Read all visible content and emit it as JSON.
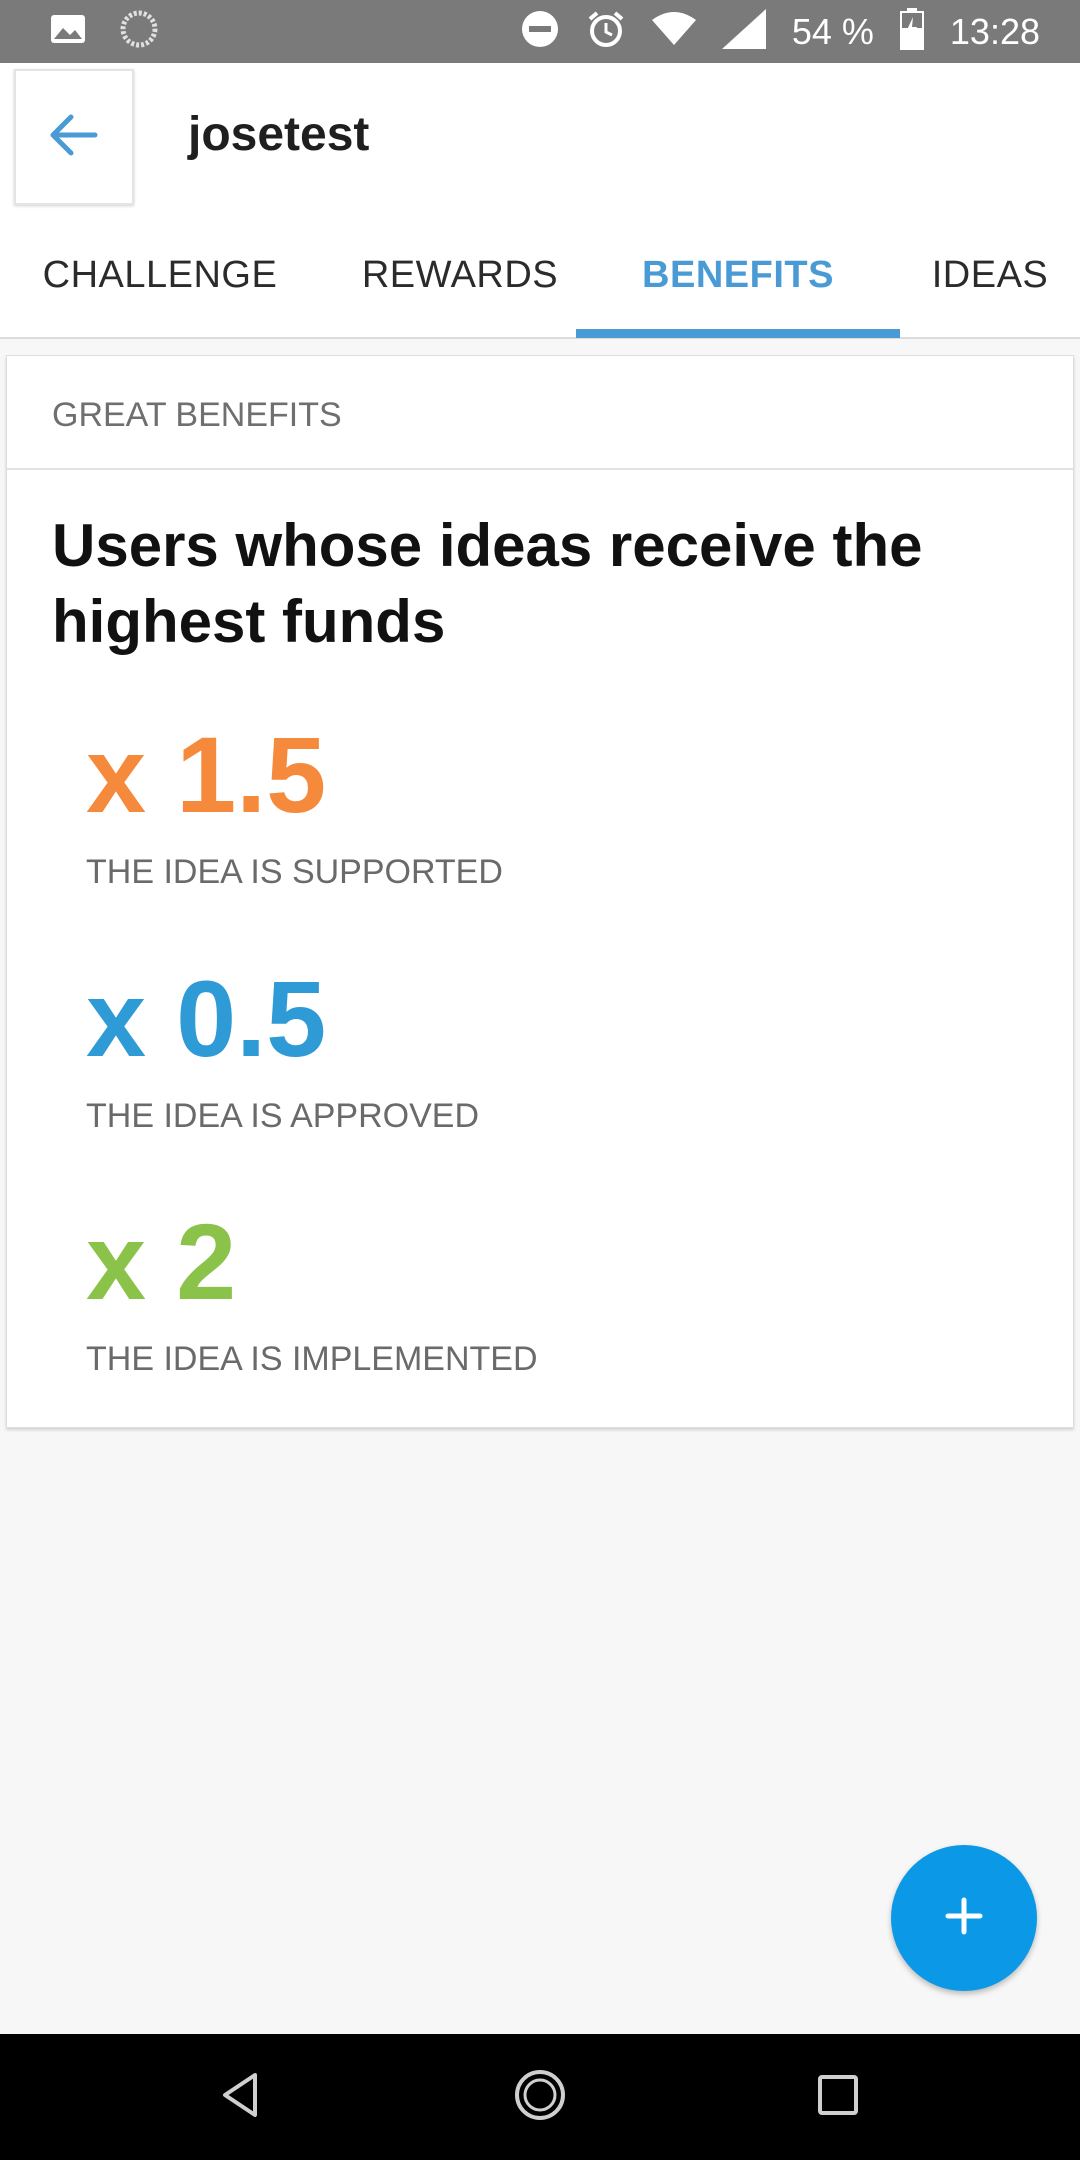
{
  "status_bar": {
    "battery_text": "54 %",
    "time": "13:28",
    "icons": [
      "image-icon",
      "sync-icon",
      "do-not-disturb-icon",
      "alarm-icon",
      "wifi-icon",
      "signal-icon",
      "battery-icon"
    ]
  },
  "app_bar": {
    "title": "josetest",
    "back_icon": "arrow-left-icon"
  },
  "tabs": [
    {
      "label": "CHALLENGE",
      "active": false
    },
    {
      "label": "REWARDS",
      "active": false
    },
    {
      "label": "BENEFITS",
      "active": true
    },
    {
      "label": "IDEAS",
      "active": false
    }
  ],
  "card": {
    "header": "GREAT BENEFITS",
    "headline": "Users whose ideas receive the highest funds",
    "benefits": [
      {
        "multiplier": "x 1.5",
        "label": "THE IDEA IS SUPPORTED",
        "color": "#f58a3c"
      },
      {
        "multiplier": "x 0.5",
        "label": "THE IDEA IS APPROVED",
        "color": "#2e9ad6"
      },
      {
        "multiplier": "x 2",
        "label": "THE IDEA IS IMPLEMENTED",
        "color": "#8bc34a"
      }
    ]
  },
  "fab": {
    "icon": "plus-icon",
    "color": "#0b98e6"
  },
  "accent_color": "#4a9ad6",
  "nav_bar": {
    "icons": [
      "back-triangle-icon",
      "home-circle-icon",
      "recents-square-icon"
    ]
  }
}
